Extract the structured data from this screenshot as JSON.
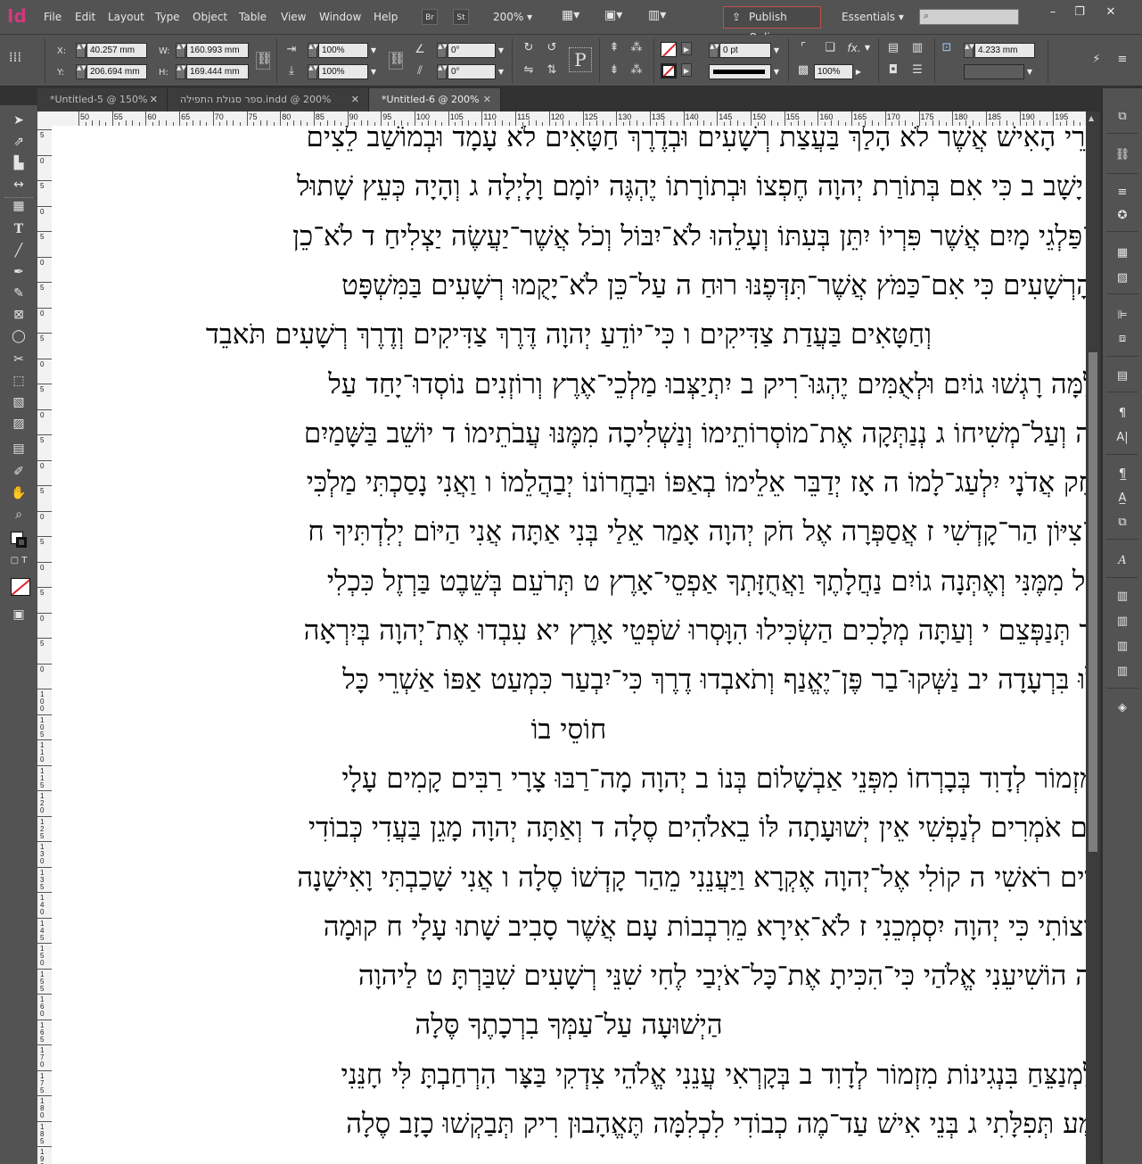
{
  "app": {
    "logo_text": "Id",
    "menus": [
      "File",
      "Edit",
      "Layout",
      "Type",
      "Object",
      "Table",
      "View",
      "Window",
      "Help"
    ],
    "bridge_label": "Br",
    "stock_label": "St",
    "zoom": "200%",
    "publish_online": "Publish Online",
    "workspace": "Essentials",
    "window_controls": [
      "–",
      "❐",
      "✕"
    ]
  },
  "control_panel": {
    "x_label": "X:",
    "x_value": "40.257 mm",
    "y_label": "Y:",
    "y_value": "206.694 mm",
    "w_label": "W:",
    "w_value": "160.993 mm",
    "h_label": "H:",
    "h_value": "169.444 mm",
    "scale_x": "100%",
    "scale_y": "100%",
    "rotate": "0°",
    "shear": "0°",
    "stroke_weight": "0 pt",
    "opacity": "100%",
    "gap": "4.233 mm",
    "text_frame_label": "P",
    "fx_label": "fx."
  },
  "tabs": [
    {
      "label": "*Untitled-5 @ 150%"
    },
    {
      "label": "ספר סגולת התפילה.indd @ 200%"
    },
    {
      "label": "*Untitled-6 @ 200%"
    }
  ],
  "ruler": {
    "h_labels": [
      "50",
      "55",
      "60",
      "65",
      "70",
      "75",
      "80",
      "85",
      "90",
      "95",
      "100",
      "105",
      "110",
      "115",
      "120",
      "125",
      "130",
      "135",
      "140",
      "145",
      "150",
      "155",
      "160",
      "165",
      "170",
      "175",
      "180",
      "185",
      "190",
      "195"
    ],
    "v_labels": [
      "5",
      "0",
      "5",
      "0",
      "5",
      "0",
      "5",
      "0",
      "5",
      "0",
      "5",
      "0",
      "5",
      "0",
      "5",
      "0",
      "5",
      "0",
      "5",
      "0",
      "5",
      "0",
      "1 0 0",
      "1 0 5",
      "1 1 0",
      "1 1 5",
      "1 2 0",
      "1 2 5",
      "1 3 0",
      "1 3 5",
      "1 4 0",
      "1 4 5",
      "1 5 0",
      "1 5 5",
      "1 6 0",
      "1 6 5",
      "1 7 0",
      "1 7 5",
      "1 8 0",
      "1 8 5",
      "1 9 0"
    ]
  },
  "document": {
    "lines": [
      {
        "text": "אַשְׁרֵי הָאִישׁ אֲשֶׁר לֹא הָלַךְ בַּעֲצַת רְשָׁעִים וּבְדֶרֶךְ חַטָּאִים לֹא עָמָד וּבְמוֹשַׁב לֵצִים",
        "align": "right"
      },
      {
        "text": "לֹא יָשָׁב ב כִּי אִם בְּתוֹרַת יְהוָה חֶפְצוֹ וּבְתוֹרָתוֹ יֶהְגֶּה יוֹמָם וָלָיְלָה ג וְהָיָה כְּעֵץ שָׁתוּל",
        "align": "right"
      },
      {
        "text": "עַל־פַּלְגֵי מָיִם אֲשֶׁר פִּרְיוֹ יִתֵּן בְּעִתּוֹ וְעָלֵהוּ לֹא־יִבּוֹל וְכֹל אֲשֶׁר־יַעֲשֶׂה יַצְלִיחַ ד לֹא־כֵן",
        "align": "right"
      },
      {
        "text": "כֵן הָרְשָׁעִים כִּי אִם־כַּמֹּץ אֲשֶׁר־תִּדְּפֶנּוּ רוּחַ ה עַל־כֵּן לֹא־יָקֻמוּ רְשָׁעִים בַּמִּשְׁפָּט",
        "align": "right"
      },
      {
        "text": "וְחַטָּאִים בַּעֲדַת צַדִּיקִים ו כִּי־יוֹדֵעַ יְהוָה דֶּרֶךְ צַדִּיקִים וְדֶרֶךְ רְשָׁעִים תֹּאבֵד",
        "align": "center"
      },
      {
        "text": "א לָמָּה רָגְשׁוּ גוֹיִם וּלְאֻמִּים יֶהְגּוּ־רִיק ב יִתְיַצְּבוּ מַלְכֵי־אֶרֶץ וְרוֹזְנִים נוֹסְדוּ־יָחַד עַל",
        "align": "right"
      },
      {
        "text": "יְהוָה וְעַל־מְשִׁיחוֹ ג נְנַתְּקָה אֶת־מוֹסְרוֹתֵימוֹ וְנַשְׁלִיכָה מִמֶּנּוּ עֲבֹתֵימוֹ ד יוֹשֵׁב בַּשָּׁמַיִם",
        "align": "right"
      },
      {
        "text": "יִשְׂחָק אֲדֹנָי יִלְעַג־לָמוֹ ה אָז יְדַבֵּר אֵלֵימוֹ בְאַפּוֹ וּבַחֲרוֹנוֹ יְבַהֲלֵמוֹ ו וַאֲנִי נָסַכְתִּי מַלְכִּי",
        "align": "right"
      },
      {
        "text": "עַל־צִיּוֹן הַר־קָדְשִׁי ז אֲסַפְּרָה אֶל חֹק יְהוָה אָמַר אֵלַי בְּנִי אַתָּה אֲנִי הַיּוֹם יְלִדְתִּיךָ ח",
        "align": "right"
      },
      {
        "text": "שְׁאַל מִמֶּנִּי וְאֶתְּנָה גוֹיִם נַחֲלָתֶךָ וַאֲחֻזָּתְךָ אַפְסֵי־אָרֶץ ט תְּרֹעֵם בְּשֵׁבֶט בַּרְזֶל כִּכְלִי",
        "align": "right"
      },
      {
        "text": "יוֹצֵר תְּנַפְּצֵם י וְעַתָּה מְלָכִים הַשְׂכִּילוּ הִוָּסְרוּ שֹׁפְטֵי אָרֶץ יא עִבְדוּ אֶת־יְהוָה בְּיִרְאָה",
        "align": "right"
      },
      {
        "text": "וְגִילוּ בִּרְעָדָה יב נַשְּׁקוּ־בַר פֶּן־יֶאֱנַף וְתֹאבְדוּ דֶרֶךְ כִּי־יִבְעַר כִּמְעַט אַפּוֹ אַשְׁרֵי כָּל",
        "align": "right"
      },
      {
        "text": "חוֹסֵי בוֹ",
        "align": "center"
      },
      {
        "text": "א מִזְמוֹר לְדָוִד בְּבָרְחוֹ מִפְּנֵי אַבְשָׁלוֹם בְּנוֹ ב יְהוָה מָה־רַבּוּ צָרָי רַבִּים קָמִים עָלָי",
        "align": "right"
      },
      {
        "text": "רַבִּים אֹמְרִים לְנַפְשִׁי אֵין יְשׁוּעָתָה לּוֹ בֵאלֹהִים סֶלָה ד וְאַתָּה יְהוָה מָגֵן בַּעֲדִי כְּבוֹדִי",
        "align": "right"
      },
      {
        "text": "וּמֵרִים רֹאשִׁי ה קוֹלִי אֶל־יְהוָה אֶקְרָא וַיַּעֲנֵנִי מֵהַר קָדְשׁוֹ סֶלָה ו אֲנִי שָׁכַבְתִּי וָאִישָׁנָה",
        "align": "right"
      },
      {
        "text": "הֱקִיצוֹתִי כִּי יְהוָה יִסְמְכֵנִי ז לֹא־אִירָא מֵרִבְבוֹת עָם אֲשֶׁר סָבִיב שָׁתוּ עָלָי ח קוּמָה",
        "align": "right"
      },
      {
        "text": "יְהוָה הוֹשִׁיעֵנִי אֱלֹהַי כִּי־הִכִּיתָ אֶת־כָּל־אֹיְבַי לֶחִי שִׁנֵּי רְשָׁעִים שִׁבַּרְתָּ ט לַיהוָה",
        "align": "right"
      },
      {
        "text": "הַיְשׁוּעָה עַל־עַמְּךָ בִרְכָתֶךָ סֶּלָה",
        "align": "center"
      },
      {
        "text": "א לַמְנַצֵּחַ בִּנְגִינוֹת מִזְמוֹר לְדָוִד ב בְּקָרְאִי עֲנֵנִי אֱלֹהֵי צִדְקִי בַּצָּר הִרְחַבְתָּ לִּי חָנֵּנִי",
        "align": "right"
      },
      {
        "text": "וּשְׁמַע תְּפִלָּתִי ג בְּנֵי אִישׁ עַד־מֶה כְבוֹדִי לִכְלִמָּה תֶּאֱהָבוּן רִיק תְּבַקְשׁוּ כָזָב סֶלָה",
        "align": "right"
      }
    ]
  },
  "colors": {
    "ui_dark": "#535353",
    "ui_darker": "#323232",
    "accent": "#d2397a",
    "publish_border": "#c0524f",
    "page": "#ffffff"
  }
}
